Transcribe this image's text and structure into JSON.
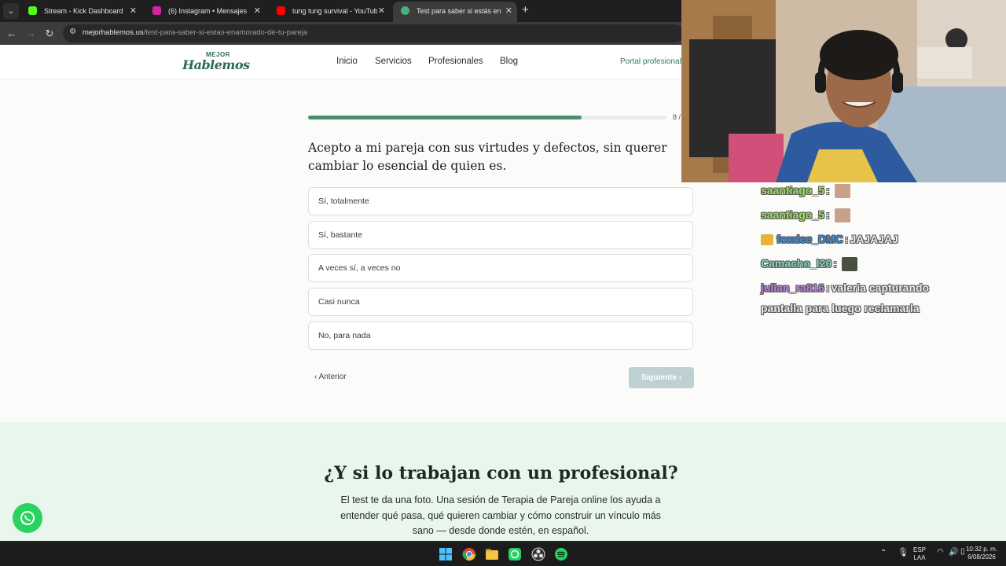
{
  "browser": {
    "tabs": [
      {
        "title": "Stream - Kick Dashboard",
        "favicon_color": "#53fc18"
      },
      {
        "title": "(6) Instagram • Mensajes",
        "favicon_color": "#d6249f"
      },
      {
        "title": "tung tung survival - YouTube",
        "favicon_color": "#ff0000"
      },
      {
        "title": "Test para saber si estás enamor",
        "favicon_color": "#4caf7d"
      }
    ],
    "url_host": "mejorhablemos.us",
    "url_path": "/test-para-saber-si-estas-enamorado-de-tu-pareja"
  },
  "site": {
    "logo_top": "MEJOR",
    "logo_main": "Hablemos",
    "nav": [
      "Inicio",
      "Servicios",
      "Profesionales",
      "Blog"
    ],
    "portal_link": "Portal profesional"
  },
  "quiz": {
    "progress_fraction": 0.8,
    "progress_label": "8 /",
    "question": "Acepto a mi pareja con sus virtudes y defectos, sin querer cambiar lo esencial de quien es.",
    "options": [
      "Sí, totalmente",
      "Sí, bastante",
      "A veces sí, a veces no",
      "Casi nunca",
      "No, para nada"
    ],
    "prev_label": "Anterior",
    "next_label": "Siguiente"
  },
  "promo": {
    "title": "¿Y si lo trabajan con un profesional?",
    "text": "El test te da una foto. Una sesión de Terapia de Pareja online los ayuda a entender qué pasa, qué quieren cambiar y cómo construir un vínculo más sano — desde donde estén, en español."
  },
  "chat": [
    {
      "user": "saantiago_5",
      "color": "#9be35a",
      "sep": ":",
      "msg": "",
      "emote": "cat"
    },
    {
      "user": "saantiago_5",
      "color": "#9be35a",
      "sep": ":",
      "msg": "",
      "emote": "cat"
    },
    {
      "user": "foxdee_DMC",
      "color": "#3a8fd8",
      "sep": ":",
      "msg": "JAJAJAJ",
      "badge": "crown"
    },
    {
      "user": "Camacho_l20",
      "color": "#86d4c2",
      "sep": ":",
      "msg": "",
      "emote": "pic"
    },
    {
      "user": "julian_ra816",
      "color": "#b97de0",
      "sep": ":",
      "msg": "valeria capturando",
      "msg2": "pantalla para luego reclamarla"
    }
  ],
  "taskbar": {
    "lang": "ESP",
    "lang_sub": "LAA",
    "time": "10:32 p. m.",
    "date": "6/08/2026"
  }
}
